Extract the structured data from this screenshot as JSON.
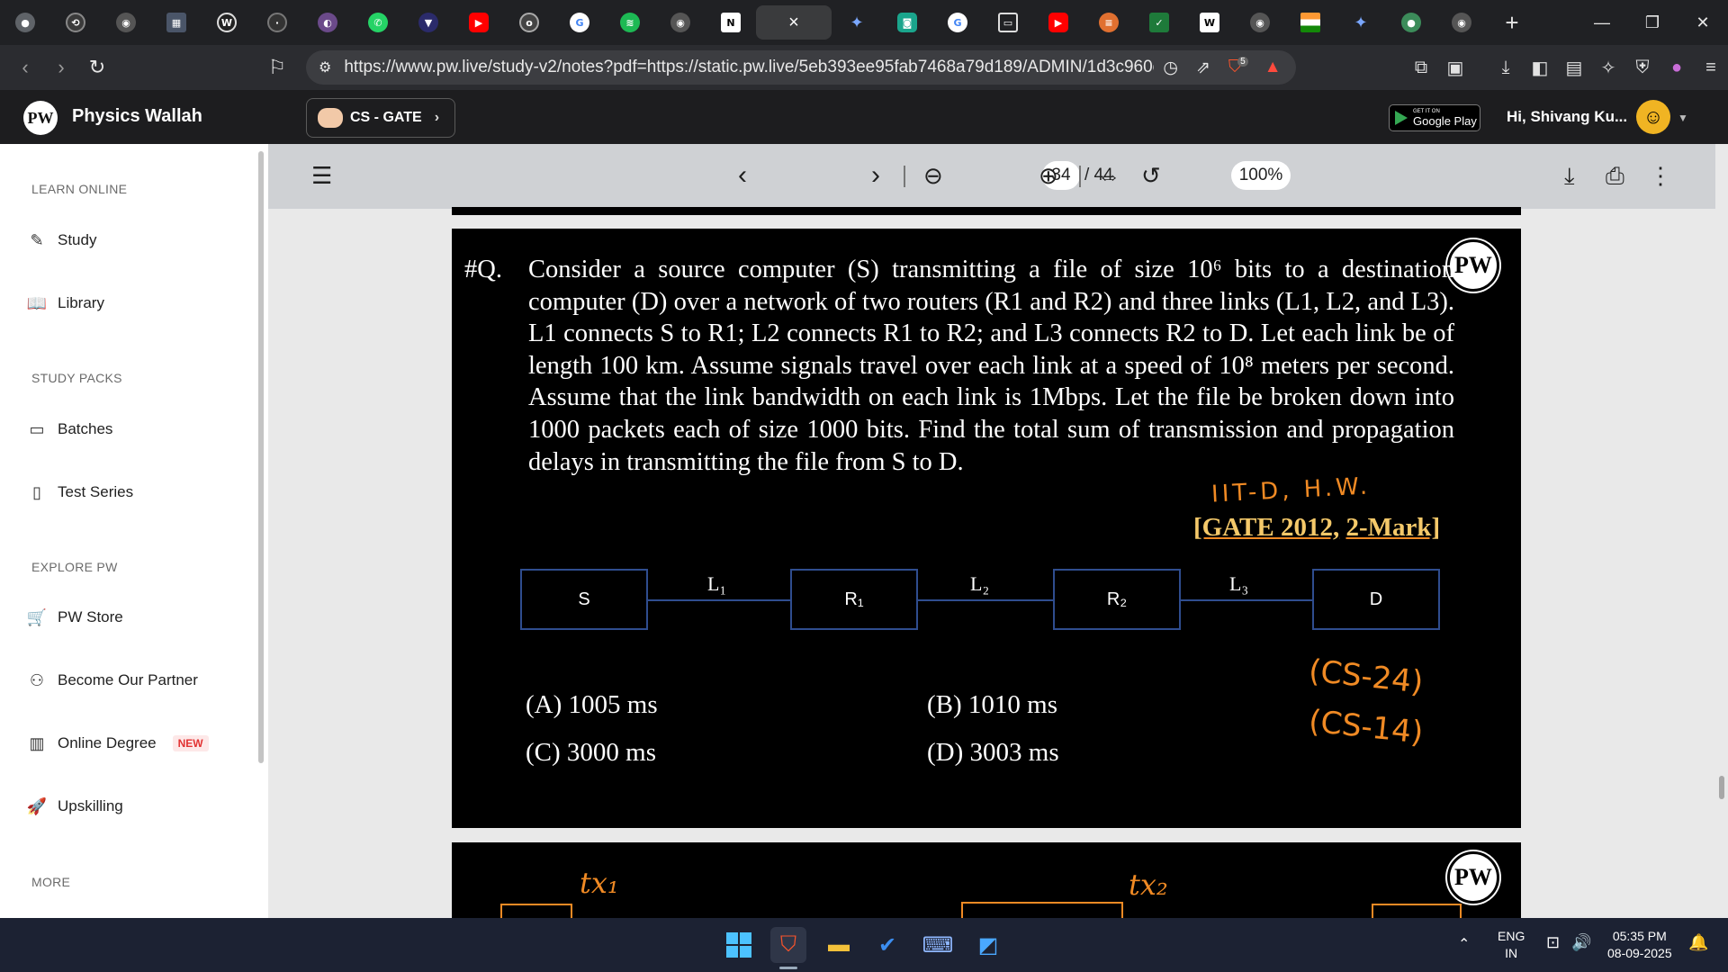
{
  "browser": {
    "url": "https://www.pw.live/study-v2/notes?pdf=https://static.pw.live/5eb393ee95fab7468a79d189/ADMIN/1d3c960e-...",
    "active_tab_close": "×",
    "new_tab": "+",
    "shield_count": "5",
    "tab_icons": [
      "chrome-icon",
      "torrent-icon",
      "globe-icon",
      "grid-icon",
      "w3schools-icon",
      "grey-circle-icon",
      "tor-icon",
      "whatsapp-icon",
      "bookmark-icon",
      "youtube-icon",
      "orkut-icon",
      "google-icon",
      "spotify-icon",
      "globe-icon",
      "notion-icon",
      "gemini-icon",
      "browser-icon",
      "google-icon",
      "monitor-icon",
      "youtube-icon",
      "flag-icon",
      "spreadsheet-icon",
      "wikipedia-icon",
      "globe-icon",
      "india-flag-icon",
      "gemini-icon",
      "green-circle-icon",
      "globe-icon"
    ]
  },
  "app": {
    "brand": "Physics Wallah",
    "logo_text": "PW",
    "course": "CS - GATE",
    "google_play_small": "GET IT ON",
    "google_play_big": "Google Play",
    "greeting": "Hi, Shivang Ku..."
  },
  "sidebar": {
    "sections": [
      {
        "title": "LEARN ONLINE",
        "items": [
          "Study",
          "Library"
        ]
      },
      {
        "title": "STUDY PACKS",
        "items": [
          "Batches",
          "Test Series"
        ]
      },
      {
        "title": "EXPLORE PW",
        "items": [
          "PW Store",
          "Become Our Partner",
          "Online Degree",
          "Upskilling"
        ]
      },
      {
        "title": "MORE",
        "items": []
      }
    ],
    "new_badge": "NEW"
  },
  "pdf": {
    "current_page": "34",
    "total_pages": "/ 44",
    "zoom": "100%"
  },
  "question": {
    "number": "#Q.",
    "body": "Consider a source computer (S) transmitting a file of size 10⁶ bits to a destination computer (D) over a network of two routers (R1 and R2) and three links (L1, L2, and L3). L1 connects S to R1; L2 connects R1 to R2; and L3 connects R2 to D. Let each link be of length 100 km. Assume signals travel over each link at a speed of 10⁸ meters per second. Assume that the link bandwidth on each link is 1Mbps. Let the file be broken down into 1000 packets each of size 1000 bits. Find the total sum of transmission and propagation delays in transmitting the file from S to D.",
    "handwritten_note": "IIT-D, H.W.",
    "gate_tag_year": "[GATE 2012,",
    "gate_tag_mark": "2-Mark]",
    "nodes": [
      "S",
      "R₁",
      "R₂",
      "D"
    ],
    "links": [
      "L₁",
      "L₂",
      "L₃"
    ],
    "options": [
      {
        "label": "(A)",
        "value": "1005 ms"
      },
      {
        "label": "(B)",
        "value": "1010 ms"
      },
      {
        "label": "(C)",
        "value": "3000 ms"
      },
      {
        "label": "(D)",
        "value": "3003 ms"
      }
    ],
    "side_notes": [
      "(CS-24)",
      "(CS-14)"
    ]
  },
  "next_page": {
    "notes": [
      "tx₁",
      "tx₂"
    ]
  },
  "taskbar": {
    "lang": "ENG",
    "region": "IN",
    "time": "05:35 PM",
    "date": "08-09-2025"
  }
}
